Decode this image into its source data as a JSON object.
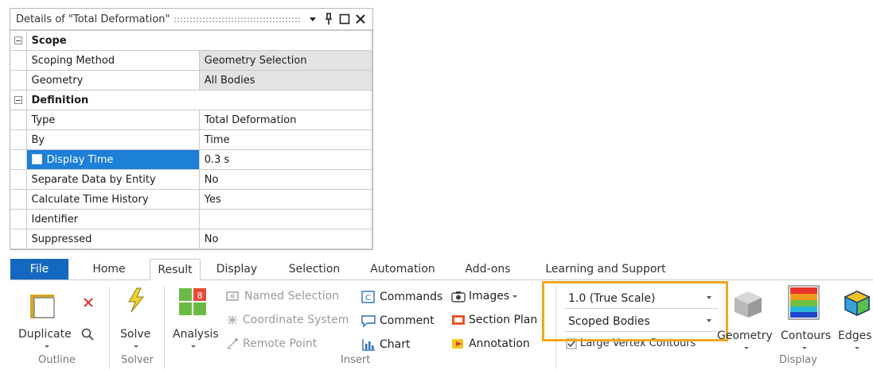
{
  "details": {
    "title": "Details of \"Total Deformation\"",
    "groups": {
      "scope": {
        "label": "Scope"
      },
      "definition": {
        "label": "Definition"
      }
    },
    "rows": {
      "scoping_method": {
        "key": "Scoping Method",
        "value": "Geometry Selection"
      },
      "geometry": {
        "key": "Geometry",
        "value": "All Bodies"
      },
      "type": {
        "key": "Type",
        "value": "Total Deformation"
      },
      "by": {
        "key": "By",
        "value": "Time"
      },
      "display_time": {
        "key": "Display Time",
        "value": "0.3 s"
      },
      "separate_data": {
        "key": "Separate Data by Entity",
        "value": "No"
      },
      "calc_time_history": {
        "key": "Calculate Time History",
        "value": "Yes"
      },
      "identifier": {
        "key": "Identifier",
        "value": ""
      },
      "suppressed": {
        "key": "Suppressed",
        "value": "No"
      }
    }
  },
  "ribbon": {
    "tabs": {
      "file": "File",
      "home": "Home",
      "result": "Result",
      "display": "Display",
      "selection": "Selection",
      "automation": "Automation",
      "addons": "Add-ons",
      "learning": "Learning and Support"
    },
    "buttons": {
      "duplicate": "Duplicate",
      "solve": "Solve",
      "analysis": "Analysis",
      "named_selection": "Named Selection",
      "coordinate_system": "Coordinate System",
      "remote_point": "Remote Point",
      "commands": "Commands",
      "comment": "Comment",
      "chart": "Chart",
      "images": "Images",
      "section_plane": "Section Plan",
      "annotation": "Annotation",
      "large_vertex_contours": "Large Vertex Contours",
      "geometry": "Geometry",
      "contours": "Contours",
      "edges": "Edges"
    },
    "dropdowns": {
      "scale": "1.0 (True Scale)",
      "bodies": "Scoped Bodies"
    },
    "groups": {
      "outline": "Outline",
      "solver": "Solver",
      "insert": "Insert",
      "display": "Display"
    }
  },
  "colors": {
    "accent": "#1568c0",
    "selection": "#1c7fd8",
    "highlight": "#f0a820"
  }
}
